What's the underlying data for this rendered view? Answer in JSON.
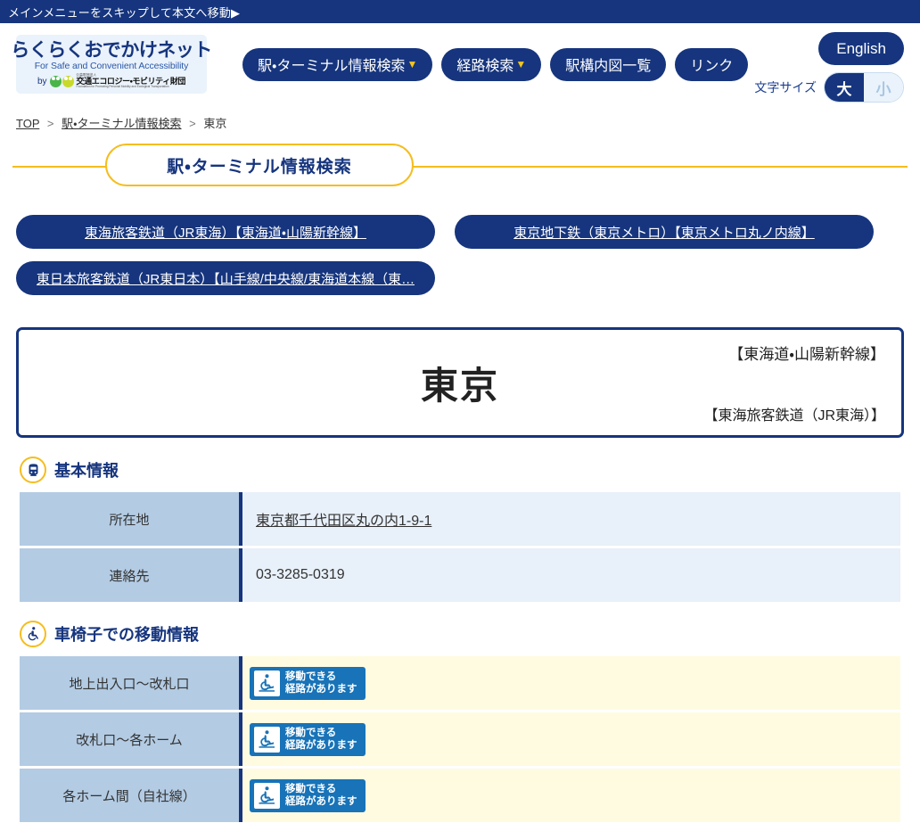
{
  "skip": {
    "label": "メインメニューをスキップして本文へ移動▶"
  },
  "header": {
    "logo": {
      "jp": "らくらくおでかけネット",
      "en": "For Safe and Convenient Accessibility",
      "by": "by",
      "foundation_small": "公益財団法人",
      "foundation_name": "交通エコロジー・モビリティ財団",
      "foundation_en": "Foundation for Promoting Personal Mobility and Ecological Transportation"
    },
    "nav": [
      {
        "label": "駅・ターミナル情報検索",
        "caret": "▼"
      },
      {
        "label": "経路検索",
        "caret": "▼"
      },
      {
        "label": "駅構内図一覧",
        "caret": ""
      },
      {
        "label": "リンク",
        "caret": ""
      }
    ],
    "english_label": "English",
    "fontsize_label": "文字サイズ",
    "fontsize_large": "大",
    "fontsize_small": "小"
  },
  "breadcrumb": {
    "top": "TOP",
    "sep": ">",
    "section": "駅・ターミナル情報検索",
    "current": "東京"
  },
  "banner": {
    "title": "駅・ターミナル情報検索"
  },
  "operators": [
    {
      "label": "東海旅客鉄道（JR東海）【東海道・山陽新幹線】"
    },
    {
      "label": "東京地下鉄（東京メトロ）【東京メトロ丸ノ内線】"
    },
    {
      "label": "東日本旅客鉄道（JR東日本）【山手線/中央線/東海道本線（東…"
    }
  ],
  "station": {
    "name": "東京",
    "line": "【東海道・山陽新幹線】",
    "operator": "【東海旅客鉄道（JR東海）】"
  },
  "basic_info": {
    "heading": "基本情報",
    "icon": "train-icon",
    "rows": [
      {
        "label": "所在地",
        "value": "東京都千代田区丸の内1-9-1",
        "is_link": true
      },
      {
        "label": "連絡先",
        "value": "03-3285-0319",
        "is_link": false
      }
    ]
  },
  "wheelchair_info": {
    "heading": "車椅子での移動情報",
    "icon": "wheelchair-icon",
    "badge": {
      "line1": "移動できる",
      "line2": "経路があります",
      "icon": "wheelchair-ramp-icon"
    },
    "rows": [
      {
        "label": "地上出入口～改札口"
      },
      {
        "label": "改札口～各ホーム"
      },
      {
        "label": "各ホーム間（自社線）"
      }
    ]
  },
  "colors": {
    "navy": "#16357e",
    "yellow": "#f5bd1f",
    "badge_blue": "#1873b8",
    "label_cell": "#b3cbe3",
    "value_cell": "#e8f0f9",
    "wc_value_cell": "#fffbe0"
  }
}
